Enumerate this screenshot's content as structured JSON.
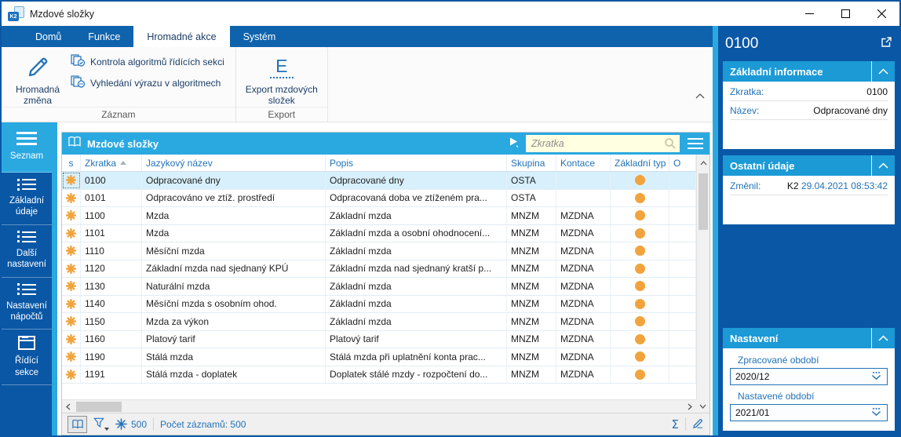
{
  "colors": {
    "dark_blue": "#0A57A5",
    "tab_bar_blue": "#0F63AD",
    "cyan_accent": "#2AA9E1",
    "card_header_blue": "#1C9AD6",
    "link_blue": "#2272B9",
    "orange": "#F2A33C",
    "search_bg": "#FFFFE1",
    "selected_row_bg": "#D7F0FB"
  },
  "window": {
    "title": "Mzdové složky",
    "logo_text": "K2"
  },
  "tabs": [
    {
      "label": "Domů",
      "active": false
    },
    {
      "label": "Funkce",
      "active": false
    },
    {
      "label": "Hromadné akce",
      "active": true
    },
    {
      "label": "Systém",
      "active": false
    }
  ],
  "ribbon": {
    "record_group": {
      "label": "Záznam",
      "big_button": {
        "line1": "Hromadná",
        "line2": "změna",
        "icon": "pencil-icon"
      },
      "small_buttons": [
        {
          "label": "Kontrola algoritmů řídících sekci",
          "icon": "documents-check-icon",
          "badge": "✓"
        },
        {
          "label": "Vyhledání výrazu v algoritmech",
          "icon": "documents-dots-icon",
          "badge": "..."
        }
      ]
    },
    "export_group": {
      "label": "Export",
      "big_button": {
        "line1": "Export mzdových",
        "line2": "složek",
        "icon": "letter-e-icon",
        "letter": "E"
      }
    }
  },
  "sidebar": {
    "items": [
      {
        "label": "Seznam",
        "icon": "menu-icon",
        "active": true
      },
      {
        "label": "Základní údaje",
        "icon": "list-icon",
        "active": false
      },
      {
        "label": "Další nastavení",
        "icon": "list-icon",
        "active": false
      },
      {
        "label": "Nastavení nápočtů",
        "icon": "list-icon",
        "active": false
      },
      {
        "label": "Řídící sekce",
        "icon": "box-icon",
        "active": false
      }
    ]
  },
  "table": {
    "title": "Mzdové složky",
    "search_placeholder": "Zkratka",
    "columns": {
      "s": "s",
      "abbr": "Zkratka",
      "lang_name": "Jazykový název",
      "desc": "Popis",
      "group": "Skupina",
      "posting": "Kontace",
      "base_type": "Základní typ",
      "o": "O"
    },
    "rows": [
      {
        "abbr": "0100",
        "lang_name": "Odpracované dny",
        "desc": "Odpracované dny",
        "group": "OSTA",
        "posting": "",
        "selected": true
      },
      {
        "abbr": "0101",
        "lang_name": "Odpracováno ve ztíž. prostředí",
        "desc": "Odpracovaná doba ve ztíženém pra...",
        "group": "OSTA",
        "posting": ""
      },
      {
        "abbr": "1100",
        "lang_name": "Mzda",
        "desc": "Základní mzda",
        "group": "MNZM",
        "posting": "MZDNA"
      },
      {
        "abbr": "1101",
        "lang_name": "Mzda",
        "desc": "Základní mzda a osobní ohodnocení...",
        "group": "MNZM",
        "posting": "MZDNA"
      },
      {
        "abbr": "1110",
        "lang_name": "Měsíční mzda",
        "desc": "Základní mzda",
        "group": "MNZM",
        "posting": "MZDNA"
      },
      {
        "abbr": "1120",
        "lang_name": "Základní mzda nad sjednaný KPÚ",
        "desc": "Základní mzda nad sjednaný kratší p...",
        "group": "MNZM",
        "posting": "MZDNA"
      },
      {
        "abbr": "1130",
        "lang_name": "Naturální mzda",
        "desc": "Základní mzda",
        "group": "MNZM",
        "posting": "MZDNA"
      },
      {
        "abbr": "1140",
        "lang_name": "Měsíční mzda s osobním ohod.",
        "desc": "Základní mzda",
        "group": "MNZM",
        "posting": "MZDNA"
      },
      {
        "abbr": "1150",
        "lang_name": "Mzda za výkon",
        "desc": "Základní mzda",
        "group": "MNZM",
        "posting": "MZDNA"
      },
      {
        "abbr": "1160",
        "lang_name": "Platový tarif",
        "desc": "Platový tarif",
        "group": "MNZM",
        "posting": "MZDNA"
      },
      {
        "abbr": "1190",
        "lang_name": "Stálá mzda",
        "desc": "Stálá mzda při uplatnění konta prac...",
        "group": "MNZM",
        "posting": "MZDNA"
      },
      {
        "abbr": "1191",
        "lang_name": "Stálá mzda - doplatek",
        "desc": "Doplatek stálé mzdy - rozpočtení do...",
        "group": "MNZM",
        "posting": "MZDNA"
      }
    ],
    "footer": {
      "limit": "500",
      "count": "Počet záznamů: 500"
    }
  },
  "detail": {
    "title": "0100",
    "basic_info": {
      "header": "Základní informace",
      "abbr_label": "Zkratka:",
      "abbr_value": "0100",
      "name_label": "Název:",
      "name_value": "Odpracované dny"
    },
    "other": {
      "header": "Ostatní údaje",
      "changed_label": "Změnil:",
      "changed_by": "K2",
      "changed_at": "29.04.2021 08:53:42"
    },
    "settings": {
      "header": "Nastavení",
      "processed_label": "Zpracované období",
      "processed_value": "2020/12",
      "set_label": "Nastavené období",
      "set_value": "2021/01"
    }
  }
}
